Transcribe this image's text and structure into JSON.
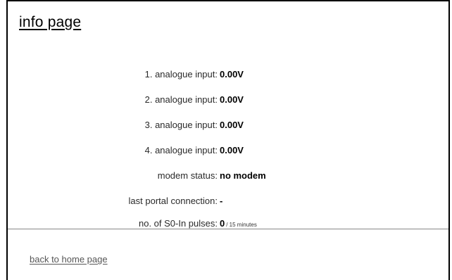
{
  "page": {
    "title": "info page"
  },
  "info": {
    "rows": [
      {
        "label": "1. analogue input:",
        "value": "0.00V"
      },
      {
        "label": "2. analogue input:",
        "value": "0.00V"
      },
      {
        "label": "3. analogue input:",
        "value": "0.00V"
      },
      {
        "label": "4. analogue input:",
        "value": "0.00V"
      },
      {
        "label": "modem status:",
        "value": "no modem"
      },
      {
        "label": "last portal connection:",
        "value": "-"
      },
      {
        "label": "no. of S0-In pulses:",
        "value": "0",
        "unit": "/ 15 minutes"
      }
    ]
  },
  "footer": {
    "back_link": "back to home page"
  }
}
